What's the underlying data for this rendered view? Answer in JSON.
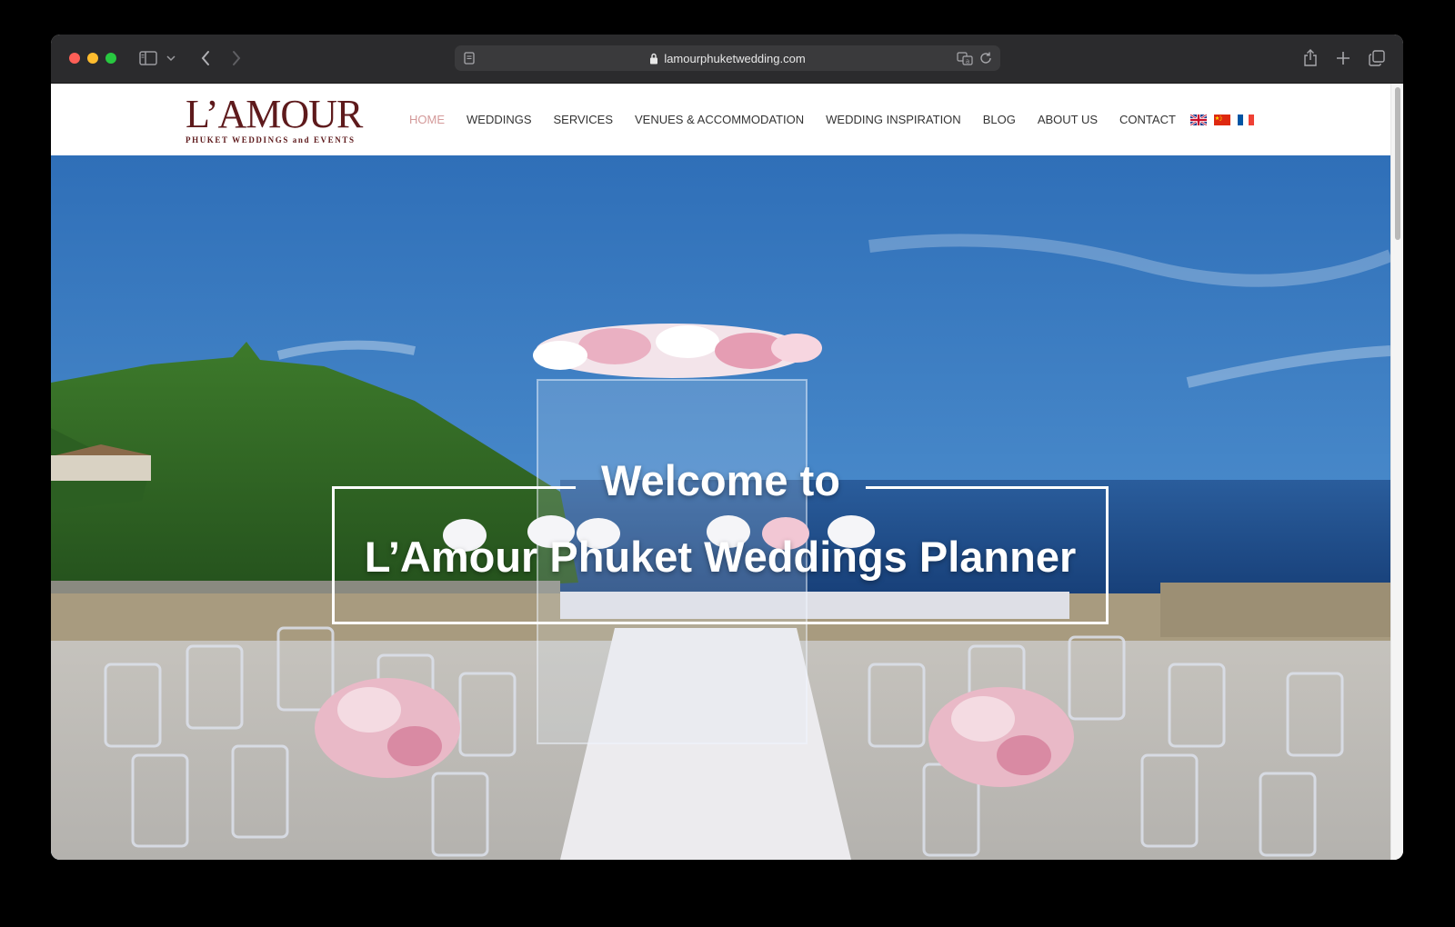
{
  "browser": {
    "url": "lamourphuketwedding.com",
    "icons": [
      "sidebar-icon",
      "chevron-down-icon",
      "back-arrow-icon",
      "forward-arrow-icon",
      "reader-icon",
      "lock-icon",
      "translate-icon",
      "reload-icon",
      "share-icon",
      "plus-icon",
      "tabs-overview-icon"
    ]
  },
  "site": {
    "logo_main": "L’AMOUR",
    "logo_sub": "PHUKET WEDDINGS and EVENTS",
    "brand_color": "#5e1a1c",
    "active_nav_color": "#d49a9a"
  },
  "nav": {
    "items": [
      {
        "label": "HOME",
        "active": true
      },
      {
        "label": "WEDDINGS",
        "active": false
      },
      {
        "label": "SERVICES",
        "active": false
      },
      {
        "label": "VENUES & ACCOMMODATION",
        "active": false
      },
      {
        "label": "WEDDING INSPIRATION",
        "active": false
      },
      {
        "label": "BLOG",
        "active": false
      },
      {
        "label": "ABOUT US",
        "active": false
      },
      {
        "label": "CONTACT",
        "active": false
      }
    ],
    "flags": [
      "uk-flag-icon",
      "china-flag-icon",
      "france-flag-icon"
    ]
  },
  "hero": {
    "line1": "Welcome to",
    "line2": "L’Amour Phuket Weddings Planner"
  }
}
